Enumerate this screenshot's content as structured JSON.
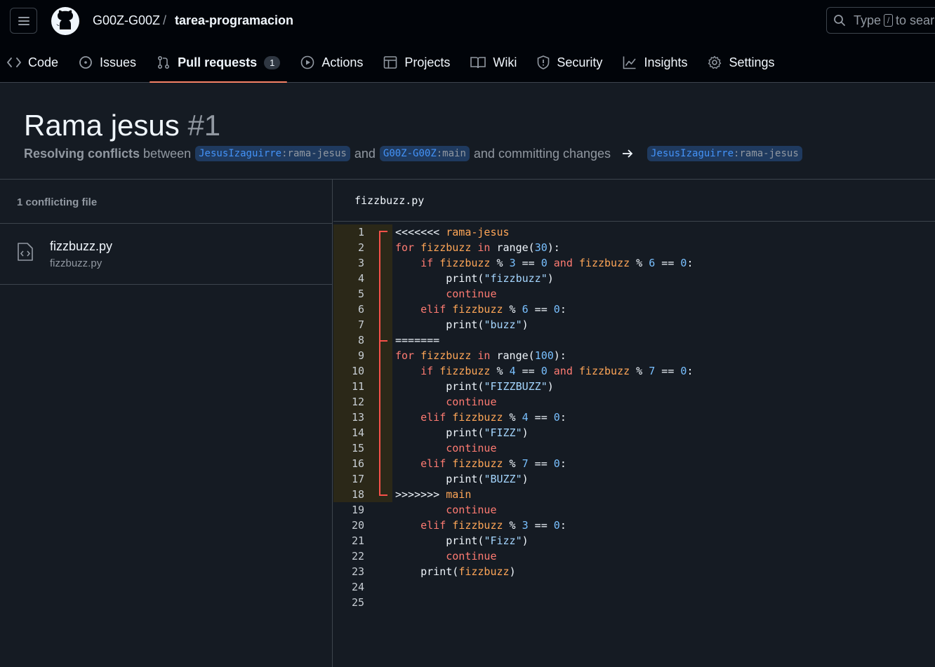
{
  "header": {
    "owner": "G00Z-G00Z",
    "separator": "/",
    "repo": "tarea-programacion",
    "search_placeholder_pre": "Type",
    "search_key": "/",
    "search_placeholder_post": "to sear"
  },
  "tabs": [
    {
      "label": "Code",
      "icon": "code-icon"
    },
    {
      "label": "Issues",
      "icon": "issue-icon"
    },
    {
      "label": "Pull requests",
      "icon": "pull-request-icon",
      "count": "1",
      "selected": true
    },
    {
      "label": "Actions",
      "icon": "play-icon"
    },
    {
      "label": "Projects",
      "icon": "table-icon"
    },
    {
      "label": "Wiki",
      "icon": "book-icon"
    },
    {
      "label": "Security",
      "icon": "shield-icon"
    },
    {
      "label": "Insights",
      "icon": "graph-icon"
    },
    {
      "label": "Settings",
      "icon": "gear-icon"
    }
  ],
  "pr": {
    "title": "Rama jesus",
    "number": "#1",
    "resolving": "Resolving conflicts",
    "between": "between",
    "head_user": "JesusIzaguirre",
    "head_branch": ":rama-jesus",
    "and": "and",
    "base_user": "G00Z-G00Z",
    "base_branch": ":main",
    "committing": "and committing changes",
    "target_user": "JesusIzaguirre",
    "target_branch": ":rama-jesus"
  },
  "sidebar": {
    "heading": "1 conflicting file",
    "files": [
      {
        "name": "fizzbuzz.py",
        "path": "fizzbuzz.py"
      }
    ]
  },
  "editor": {
    "filename": "fizzbuzz.py",
    "conflict_lines": [
      1,
      18
    ],
    "lines": [
      "<<<<<<< rama-jesus",
      "for fizzbuzz in range(30):",
      "    if fizzbuzz % 3 == 0 and fizzbuzz % 6 == 0:",
      "        print(\"fizzbuzz\")",
      "        continue",
      "    elif fizzbuzz % 6 == 0:",
      "        print(\"buzz\")",
      "=======",
      "for fizzbuzz in range(100):",
      "    if fizzbuzz % 4 == 0 and fizzbuzz % 7 == 0:",
      "        print(\"FIZZBUZZ\")",
      "        continue",
      "    elif fizzbuzz % 4 == 0:",
      "        print(\"FIZZ\")",
      "        continue",
      "    elif fizzbuzz % 7 == 0:",
      "        print(\"BUZZ\")",
      ">>>>>>> main",
      "        continue",
      "    elif fizzbuzz % 3 == 0:",
      "        print(\"Fizz\")",
      "        continue",
      "    print(fizzbuzz)",
      "",
      ""
    ]
  },
  "colors": {
    "accent": "#f78166",
    "link": "#4493f8",
    "keyword": "#ff7b72",
    "variable": "#ffa657",
    "number": "#79c0ff",
    "string": "#a5d6ff",
    "conflict_marker": "#f85149"
  }
}
